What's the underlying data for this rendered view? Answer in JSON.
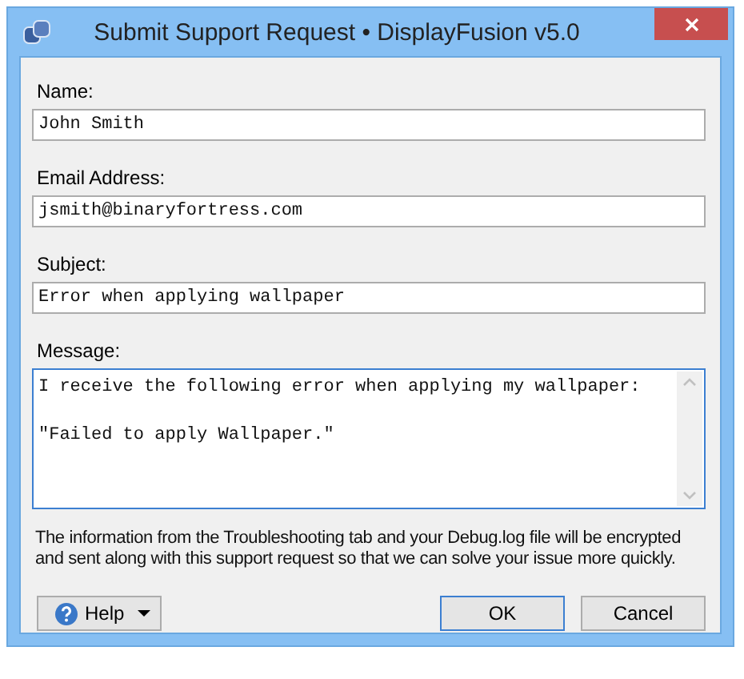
{
  "window": {
    "title": "Submit Support Request • DisplayFusion v5.0"
  },
  "fields": [
    {
      "kind": "line",
      "label": "Name:",
      "value": "John Smith",
      "focused": false
    },
    {
      "kind": "line",
      "label": "Email Address:",
      "value": "jsmith@binaryfortress.com",
      "focused": false
    },
    {
      "kind": "line",
      "label": "Subject:",
      "value": "Error when applying wallpaper",
      "focused": false
    },
    {
      "kind": "multiline",
      "label": "Message:",
      "value": "I receive the following error when applying my wallpaper:\n\n\"Failed to apply Wallpaper.\"",
      "focused": true
    }
  ],
  "note": "The information from the Troubleshooting tab and your Debug.log file will be encrypted and sent along with this support request so that we can solve your issue more quickly.",
  "help_button": {
    "label": "Help"
  },
  "buttons": [
    {
      "label": "OK",
      "default": true
    },
    {
      "label": "Cancel",
      "default": false
    }
  ]
}
